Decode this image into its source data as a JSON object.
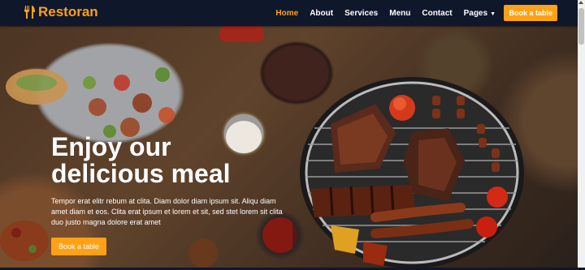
{
  "brand": {
    "name": "Restoran",
    "icon": "utensils-icon",
    "color": "#fea116"
  },
  "nav": {
    "links": [
      {
        "label": "Home",
        "active": true
      },
      {
        "label": "About",
        "active": false
      },
      {
        "label": "Services",
        "active": false
      },
      {
        "label": "Menu",
        "active": false
      },
      {
        "label": "Contact",
        "active": false
      },
      {
        "label": "Pages",
        "active": false
      }
    ],
    "cta": "Book a table"
  },
  "hero": {
    "title_line1": "Enjoy our",
    "title_line2": "delicious meal",
    "description": "Tempor erat elitr rebum at clita. Diam dolor diam ipsum sit. Aliqu diam amet diam et eos. Clita erat ipsum et lorem et sit, sed stet lorem sit clita duo justo magna dolore erat amet",
    "button": "Book a table"
  },
  "colors": {
    "accent": "#fea116",
    "dark": "#0f172b"
  }
}
